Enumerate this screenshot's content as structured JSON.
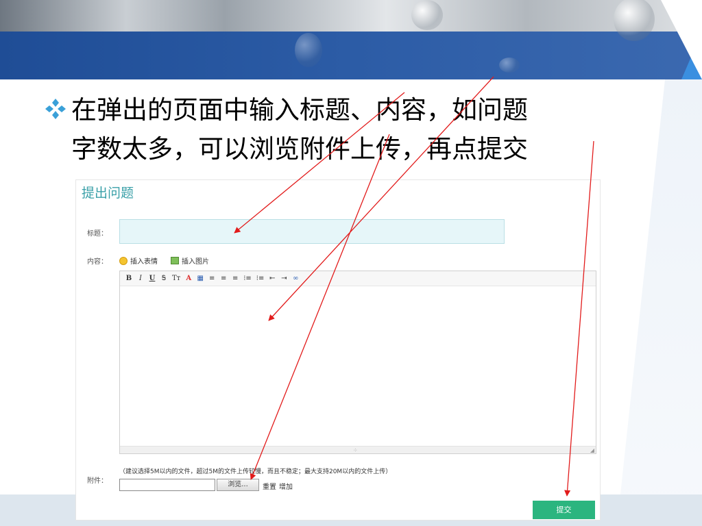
{
  "slide": {
    "bullet_line1": "在弹出的页面中输入标题、内容，如问题",
    "bullet_line2": "字数太多，可以浏览附件上传，再点提交",
    "bullet_icon": "diamond-bullet-icon"
  },
  "form": {
    "heading": "提出问题",
    "title_label": "标题：",
    "title_value": "",
    "content_label": "内容：",
    "insert_emoji": "插入表情",
    "insert_image": "插入图片",
    "toolbar": [
      "B",
      "I",
      "U",
      "Ꭶ",
      "Tт",
      "A",
      "▦",
      "≡",
      "≡",
      "≡",
      "⁝≡",
      "⁝≡",
      "⇤",
      "⇥",
      "∞"
    ],
    "content_value": "",
    "attachment_label": "附件：",
    "attachment_note": "（建议选择5M以内的文件，超过5M的文件上传较慢，而且不稳定；最大支持20M以内的文件上传）",
    "browse_label": "浏览...",
    "reset_label": "重置",
    "add_label": "增加",
    "submit_label": "提交"
  },
  "colors": {
    "banner_blue": "#2c5ca6",
    "accent_cyan": "#3aa0a8",
    "submit_green": "#2bb57f",
    "arrow_red": "#e21b1b"
  }
}
